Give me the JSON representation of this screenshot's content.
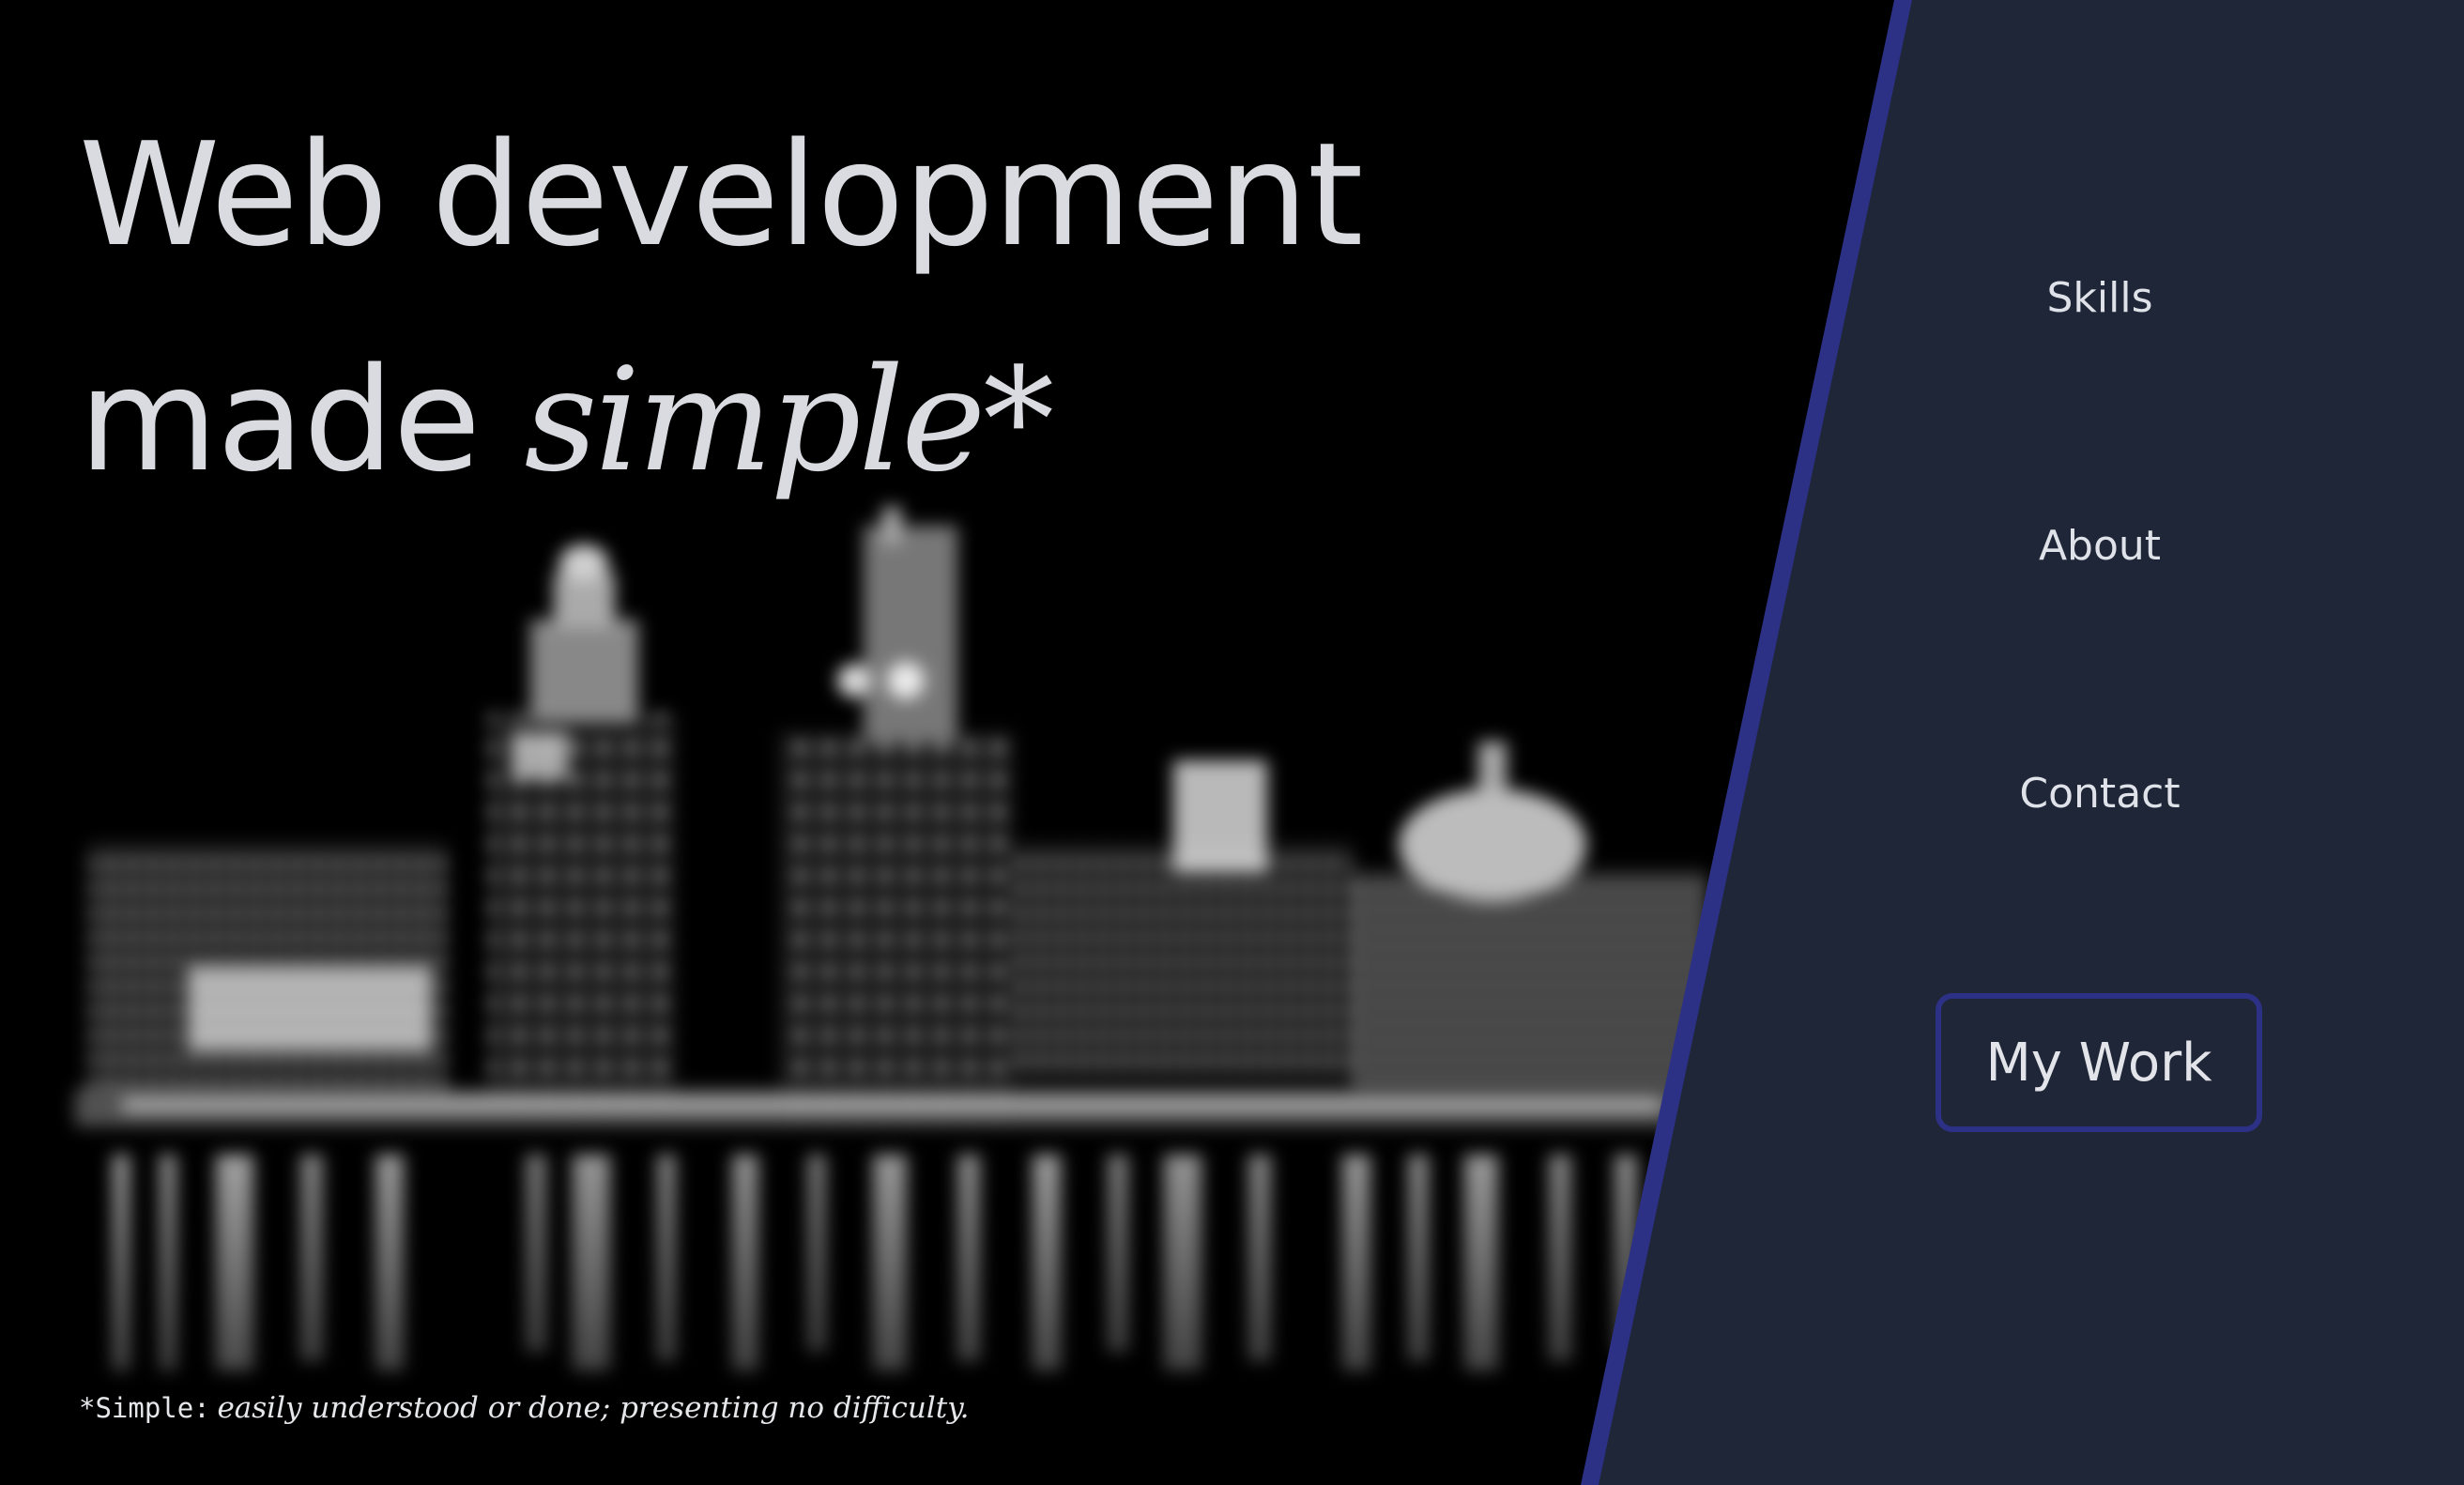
{
  "hero": {
    "headline_line1": "Web development",
    "headline_line2_prefix": "made ",
    "headline_line2_emphasis": "simple*",
    "footnote_term": "*Simple:",
    "footnote_definition": "easily understood or done; presenting no difficulty."
  },
  "nav": {
    "items": [
      {
        "label": "Skills"
      },
      {
        "label": "About"
      },
      {
        "label": "Contact"
      }
    ],
    "cta_label": "My Work"
  },
  "colors": {
    "panel_background": "#1e2637",
    "accent": "#2d3185",
    "text": "#d9dbe0",
    "hero_background": "#000000"
  }
}
